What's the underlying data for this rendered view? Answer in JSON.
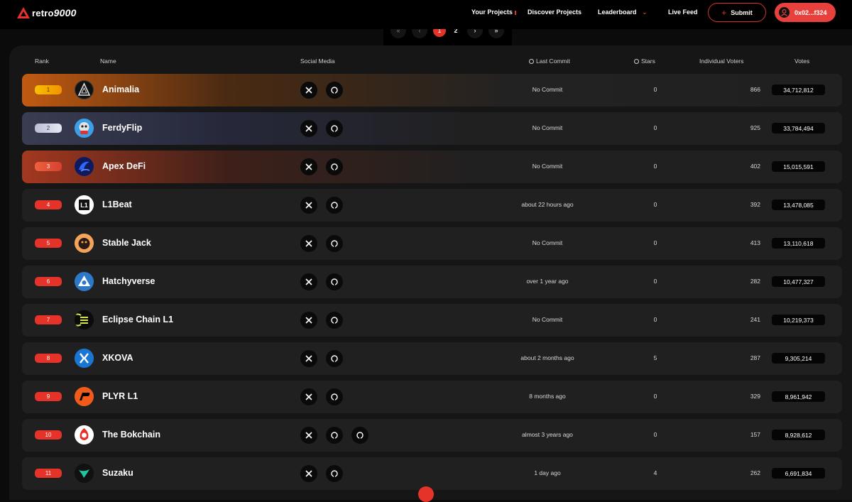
{
  "nav": {
    "logo_text": "retro",
    "logo_num": "9000",
    "links": [
      "Your Projects",
      "Discover Projects",
      "Leaderboard",
      "Live Feed"
    ],
    "submit_label": "Submit",
    "wallet_label": "0x02...f324"
  },
  "pager": {
    "pages": [
      "1",
      "2"
    ],
    "active_page": "1"
  },
  "table": {
    "headers": {
      "rank": "Rank",
      "name": "Name",
      "social": "Social Media",
      "commit": "Last Commit",
      "stars": "Stars",
      "voters": "Individual Voters",
      "votes": "Votes"
    },
    "rows": [
      {
        "rank": "1",
        "name": "Animalia",
        "commit": "No Commit",
        "stars": "0",
        "voters": "866",
        "votes": "34,712,812",
        "socials": [
          "x-icon",
          "github-icon"
        ]
      },
      {
        "rank": "2",
        "name": "FerdyFlip",
        "commit": "No Commit",
        "stars": "0",
        "voters": "925",
        "votes": "33,784,494",
        "socials": [
          "x-icon",
          "github-icon"
        ]
      },
      {
        "rank": "3",
        "name": "Apex DeFi",
        "commit": "No Commit",
        "stars": "0",
        "voters": "402",
        "votes": "15,015,591",
        "socials": [
          "x-icon",
          "github-icon"
        ]
      },
      {
        "rank": "4",
        "name": "L1Beat",
        "commit": "about 22 hours ago",
        "stars": "0",
        "voters": "392",
        "votes": "13,478,085",
        "socials": [
          "x-icon",
          "github-icon"
        ]
      },
      {
        "rank": "5",
        "name": "Stable Jack",
        "commit": "No Commit",
        "stars": "0",
        "voters": "413",
        "votes": "13,110,618",
        "socials": [
          "x-icon",
          "github-icon"
        ]
      },
      {
        "rank": "6",
        "name": "Hatchyverse",
        "commit": "over 1 year ago",
        "stars": "0",
        "voters": "282",
        "votes": "10,477,327",
        "socials": [
          "x-icon",
          "github-icon"
        ]
      },
      {
        "rank": "7",
        "name": "Eclipse Chain L1",
        "commit": "No Commit",
        "stars": "0",
        "voters": "241",
        "votes": "10,219,373",
        "socials": [
          "x-icon",
          "github-icon"
        ]
      },
      {
        "rank": "8",
        "name": "XKOVA",
        "commit": "about 2 months ago",
        "stars": "5",
        "voters": "287",
        "votes": "9,305,214",
        "socials": [
          "x-icon",
          "github-icon"
        ]
      },
      {
        "rank": "9",
        "name": "PLYR L1",
        "commit": "8 months ago",
        "stars": "0",
        "voters": "329",
        "votes": "8,961,942",
        "socials": [
          "x-icon",
          "github-icon"
        ]
      },
      {
        "rank": "10",
        "name": "The Bokchain",
        "commit": "almost 3 years ago",
        "stars": "0",
        "voters": "157",
        "votes": "8,928,612",
        "socials": [
          "x-icon",
          "github-icon",
          "github-icon"
        ]
      },
      {
        "rank": "11",
        "name": "Suzaku",
        "commit": "1 day ago",
        "stars": "4",
        "voters": "262",
        "votes": "6,691,834",
        "socials": [
          "x-icon",
          "github-icon"
        ]
      }
    ]
  },
  "colors": {
    "accent": "#e5332a",
    "gold": "#f5b400",
    "silver": "#c9cde0",
    "bronze": "#e86a4a"
  }
}
